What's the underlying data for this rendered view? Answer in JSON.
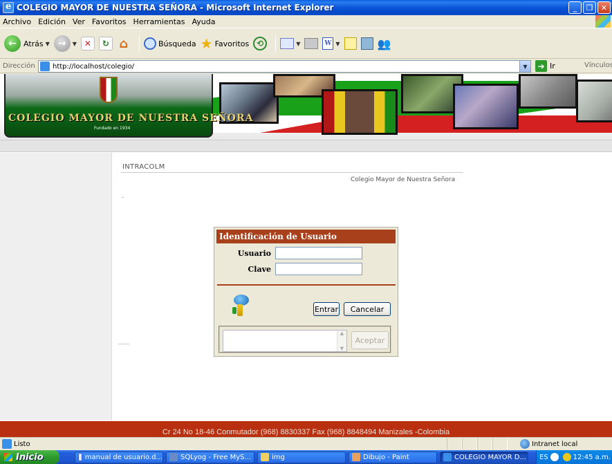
{
  "window": {
    "title": "COLEGIO MAYOR DE NUESTRA SEÑORA - Microsoft Internet Explorer"
  },
  "menu": [
    "Archivo",
    "Edición",
    "Ver",
    "Favoritos",
    "Herramientas",
    "Ayuda"
  ],
  "toolbar": {
    "back_label": "Atrás",
    "search_label": "Búsqueda",
    "favorites_label": "Favoritos"
  },
  "address": {
    "label": "Dirección",
    "url": "http://localhost/colegio/",
    "go_label": "Ir",
    "links_label": "Vínculos"
  },
  "page": {
    "school_name": "COLEGIO MAYOR DE NUESTRA SEÑORA",
    "founded": "Fundado en 1934",
    "site_name": "INTRACOLM",
    "subtitle": "Colegio Mayor de Nuestra Señora",
    "footer": "Cr 24 No 18-46 Conmutador (968) 8830337 Fax (968) 8848494 Manizales -Colombia"
  },
  "login": {
    "title": "Identificación de Usuario",
    "user_label": "Usuario",
    "user_value": "",
    "password_label": "Clave",
    "password_value": "",
    "enter_label": "Entrar",
    "cancel_label": "Cancelar",
    "accept_label": "Aceptar"
  },
  "statusbar": {
    "status": "Listo",
    "zone": "Intranet local"
  },
  "taskbar": {
    "start_label": "Inicio",
    "tasks": [
      "manual de usuario.d...",
      "SQLyog - Free MyS...",
      "img",
      "Dibujo - Paint",
      "COLEGIO MAYOR D..."
    ],
    "lang": "ES",
    "clock": "12:45 a.m."
  }
}
